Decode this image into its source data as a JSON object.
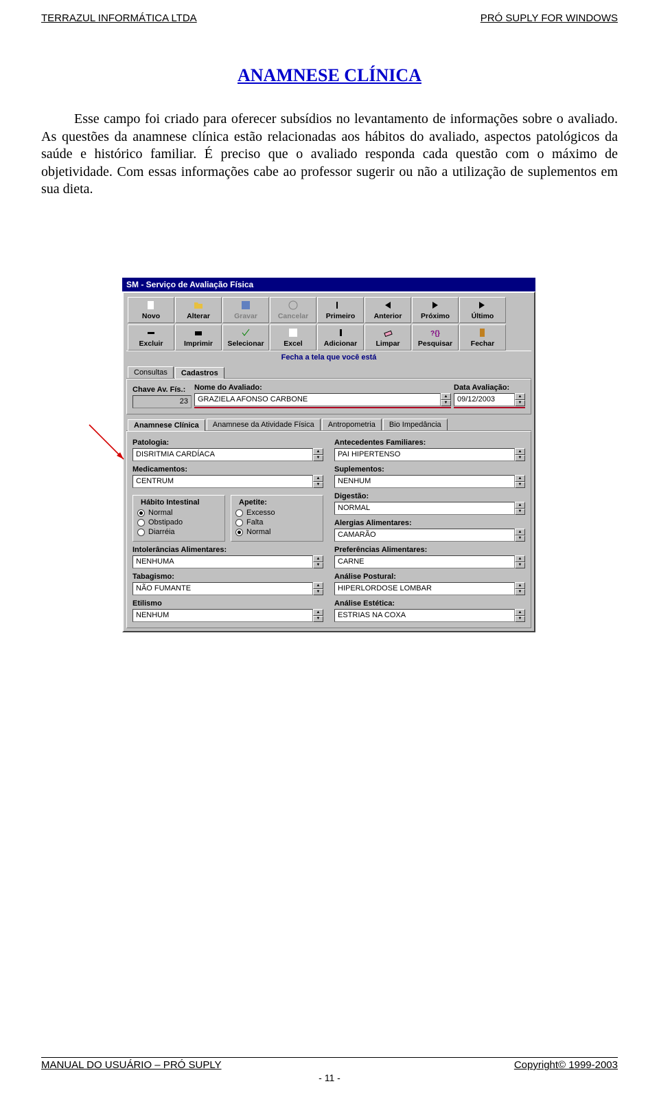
{
  "header": {
    "left": "TERRAZUL INFORMÁTICA LTDA",
    "right": "PRÓ SUPLY FOR WINDOWS"
  },
  "title": "ANAMNESE CLÍNICA",
  "body": "Esse campo foi criado para oferecer subsídios no levantamento de informações sobre o avaliado. As questões da anamnese clínica estão relacionadas aos hábitos do avaliado, aspectos patológicos da saúde e histórico familiar. É preciso que o avaliado responda cada questão com o máximo de objetividade. Com essas informações cabe ao professor sugerir ou não a utilização de suplementos em sua dieta.",
  "window": {
    "title": "SM  -  Serviço de Avaliação Física",
    "toolbar1": [
      {
        "label": "Novo",
        "disabled": false,
        "icon": "file"
      },
      {
        "label": "Alterar",
        "disabled": false,
        "icon": "folder"
      },
      {
        "label": "Gravar",
        "disabled": true,
        "icon": "disk"
      },
      {
        "label": "Cancelar",
        "disabled": true,
        "icon": "nosign"
      },
      {
        "label": "Primeiro",
        "disabled": false,
        "icon": "first"
      },
      {
        "label": "Anterior",
        "disabled": false,
        "icon": "prev"
      },
      {
        "label": "Próximo",
        "disabled": false,
        "icon": "next"
      },
      {
        "label": "Último",
        "disabled": false,
        "icon": "last"
      }
    ],
    "toolbar2": [
      {
        "label": "Excluir",
        "disabled": false,
        "icon": "minus"
      },
      {
        "label": "Imprimir",
        "disabled": false,
        "icon": "print"
      },
      {
        "label": "Selecionar",
        "disabled": false,
        "icon": "check"
      },
      {
        "label": "Excel",
        "disabled": false,
        "icon": "excel"
      },
      {
        "label": "Adicionar",
        "disabled": false,
        "icon": "plus"
      },
      {
        "label": "Limpar",
        "disabled": false,
        "icon": "eraser"
      },
      {
        "label": "Pesquisar",
        "disabled": false,
        "icon": "search"
      },
      {
        "label": "Fechar",
        "disabled": false,
        "icon": "door"
      }
    ],
    "status_line": "Fecha a tela que você está",
    "tabs_main": [
      "Consultas",
      "Cadastros"
    ],
    "tabs_main_active": 1,
    "header_fields": {
      "chave_label": "Chave Av. Fís.:",
      "chave_value": "23",
      "nome_label": "Nome do Avaliado:",
      "nome_value": "GRAZIELA AFONSO CARBONE",
      "data_label": "Data Avaliação:",
      "data_value": "09/12/2003"
    },
    "tabs_sub": [
      "Anamnese Clínica",
      "Anamnese da Atividade Física",
      "Antropometria",
      "Bio Impedância"
    ],
    "tabs_sub_active": 0,
    "form": {
      "patologia_label": "Patologia:",
      "patologia_value": "DISRITMIA CARDÍACA",
      "antecedentes_label": "Antecedentes Familiares:",
      "antecedentes_value": "PAI HIPERTENSO",
      "medicamentos_label": "Medicamentos:",
      "medicamentos_value": "CENTRUM",
      "suplementos_label": "Suplementos:",
      "suplementos_value": "NENHUM",
      "digestao_label": "Digestão:",
      "digestao_value": "NORMAL",
      "habito_legend": "Hábito Intestinal",
      "habito_options": [
        "Normal",
        "Obstipado",
        "Diarréia"
      ],
      "habito_selected": 0,
      "apetite_legend": "Apetite:",
      "apetite_options": [
        "Excesso",
        "Falta",
        "Normal"
      ],
      "apetite_selected": 2,
      "alergias_label": "Alergias Alimentares:",
      "alergias_value": "CAMARÃO",
      "intoler_label": "Intolerâncias Alimentares:",
      "intoler_value": "NENHUMA",
      "prefer_label": "Preferências Alimentares:",
      "prefer_value": "CARNE",
      "tabagismo_label": "Tabagismo:",
      "tabagismo_value": "NÃO FUMANTE",
      "postural_label": "Análise Postural:",
      "postural_value": "HIPERLORDOSE LOMBAR",
      "etilismo_label": "Etilismo",
      "etilismo_value": "NENHUM",
      "estetica_label": "Análise Estética:",
      "estetica_value": "ESTRIAS NA COXA"
    }
  },
  "footer": {
    "left": "MANUAL DO USUÁRIO – PRÓ SUPLY",
    "right": "Copyright©  1999-2003",
    "page": "- 11 -"
  }
}
